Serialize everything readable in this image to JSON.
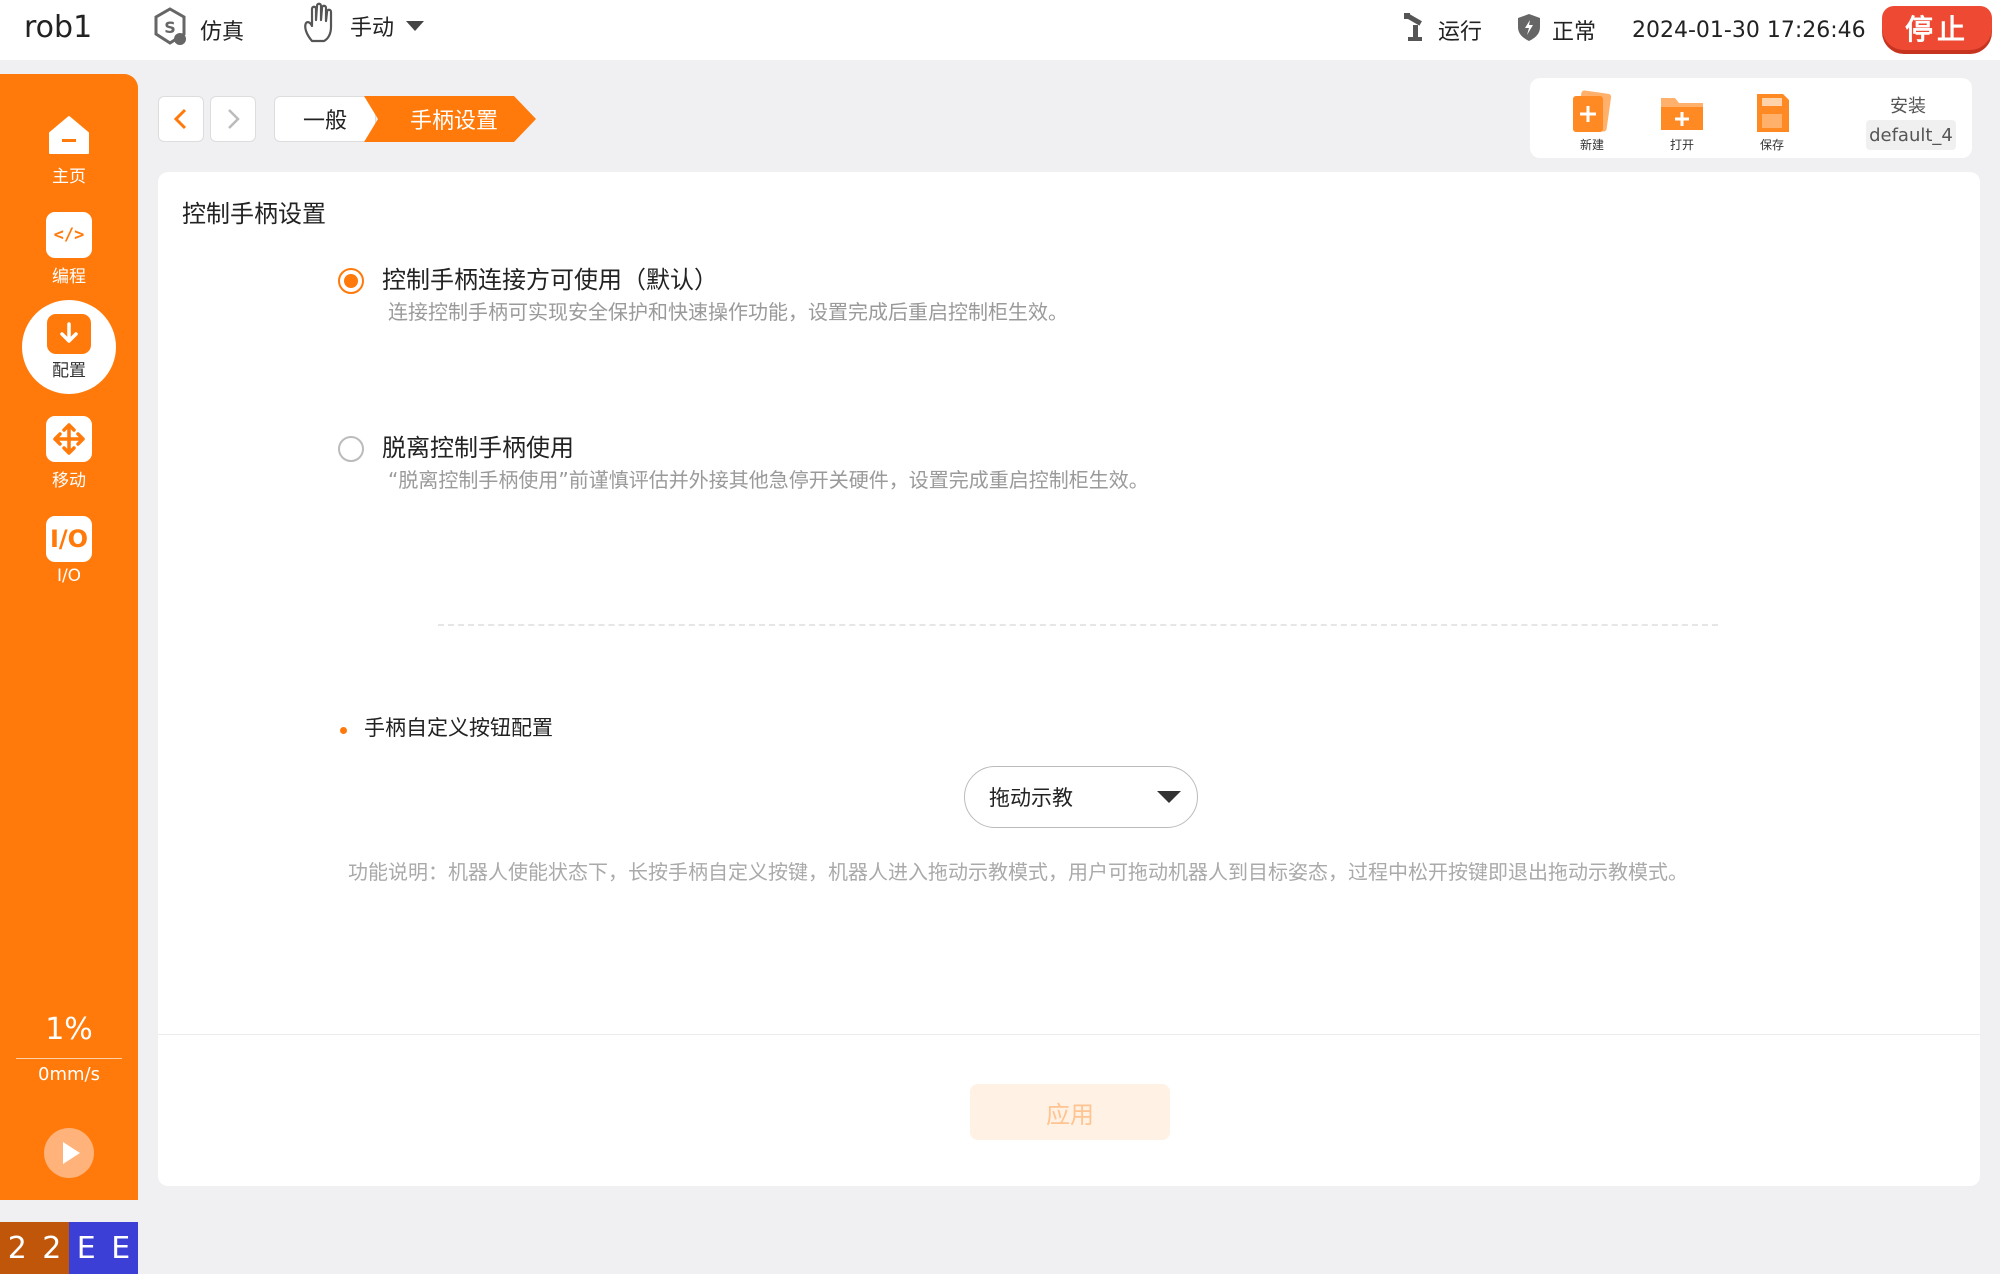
{
  "header": {
    "robot_name": "rob1",
    "mode_sim": "仿真",
    "mode_manual": "手动",
    "run_state": "运行",
    "safety_state": "正常",
    "datetime": "2024-01-30 17:26:46",
    "stop_label": "停止"
  },
  "sidebar": {
    "items": [
      {
        "label": "主页",
        "icon": "home-icon"
      },
      {
        "label": "编程",
        "icon": "code-icon"
      },
      {
        "label": "配置",
        "icon": "config-icon"
      },
      {
        "label": "移动",
        "icon": "move-icon"
      },
      {
        "label": "I/O",
        "icon": "io-icon"
      }
    ],
    "active_index": 2,
    "speed_percent": "1%",
    "speed_mm": "0mm/s",
    "status_chars": [
      {
        "ch": "2",
        "color": "#c0560a"
      },
      {
        "ch": "2",
        "color": "#c0560a"
      },
      {
        "ch": "E",
        "color": "#3b3fd6"
      },
      {
        "ch": "E",
        "color": "#3b3fd6"
      }
    ]
  },
  "breadcrumb": {
    "items": [
      "一般",
      "手柄设置"
    ]
  },
  "file_toolbar": {
    "new_label": "新建",
    "open_label": "打开",
    "save_label": "保存",
    "install_label": "安装",
    "install_value": "default_4"
  },
  "main": {
    "title": "控制手柄设置",
    "options": [
      {
        "label": "控制手柄连接方可使用（默认）",
        "desc": "连接控制手柄可实现安全保护和快速操作功能，设置完成后重启控制柜生效。",
        "selected": true
      },
      {
        "label": "脱离控制手柄使用",
        "desc": "“脱离控制手柄使用”前谨慎评估并外接其他急停开关硬件，设置完成重启控制柜生效。",
        "selected": false
      }
    ],
    "custom_button_label": "手柄自定义按钮配置",
    "dropdown_value": "拖动示教",
    "function_desc": "功能说明：机器人使能状态下，长按手柄自定义按键，机器人进入拖动示教模式，用户可拖动机器人到目标姿态，过程中松开按键即退出拖动示教模式。",
    "apply_label": "应用"
  },
  "colors": {
    "accent": "#ff7a0a",
    "stop": "#ee4a33"
  }
}
